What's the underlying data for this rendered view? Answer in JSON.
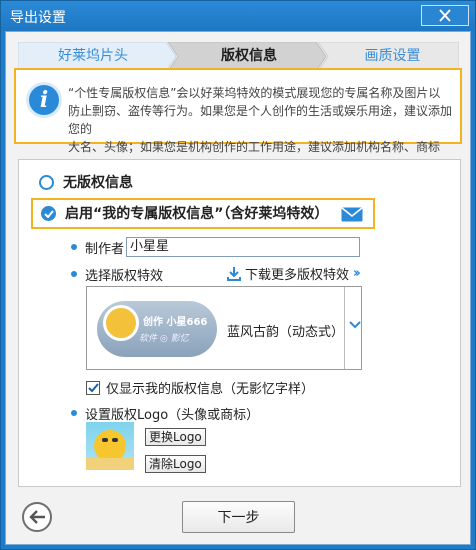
{
  "window": {
    "title": "导出设置"
  },
  "steps": [
    {
      "label": "好莱坞片头",
      "state": "done"
    },
    {
      "label": "版权信息",
      "state": "active"
    },
    {
      "label": "画质设置",
      "state": "todo"
    }
  ],
  "info": {
    "lines": [
      "“个性专属版权信息”会以好莱坞特效的模式展现您的专属名称及图片以",
      "防止剽窃、盗传等行为。如果您是个人创作的生活或娱乐用途，建议添加您的",
      "大名、头像；如果您是机构创作的工作用途，建议添加机构名称、商标"
    ]
  },
  "options": {
    "no_copyright": "无版权信息",
    "enable_copyright": "启用“我的专属版权信息”（含好莱坞特效）",
    "selected": "enable_copyright"
  },
  "author": {
    "label": "制作者",
    "value": "小星星"
  },
  "effect": {
    "label": "选择版权特效",
    "download_link": "下载更多版权特效",
    "selected_name": "蓝风古韵（动态式）",
    "thumb_line1": "创作 小星666",
    "thumb_line2": "软件 ◎ 影忆"
  },
  "only_mine": {
    "label": "仅显示我的版权信息（无影忆字样）",
    "checked": true
  },
  "logo": {
    "label": "设置版权Logo（头像或商标）",
    "change_button": "更换Logo",
    "clear_button": "清除Logo"
  },
  "footer": {
    "next_button": "下一步"
  },
  "colors": {
    "accent": "#2b8ad8",
    "highlight": "#f3b21f",
    "titlebar": "#1f7cc8"
  }
}
